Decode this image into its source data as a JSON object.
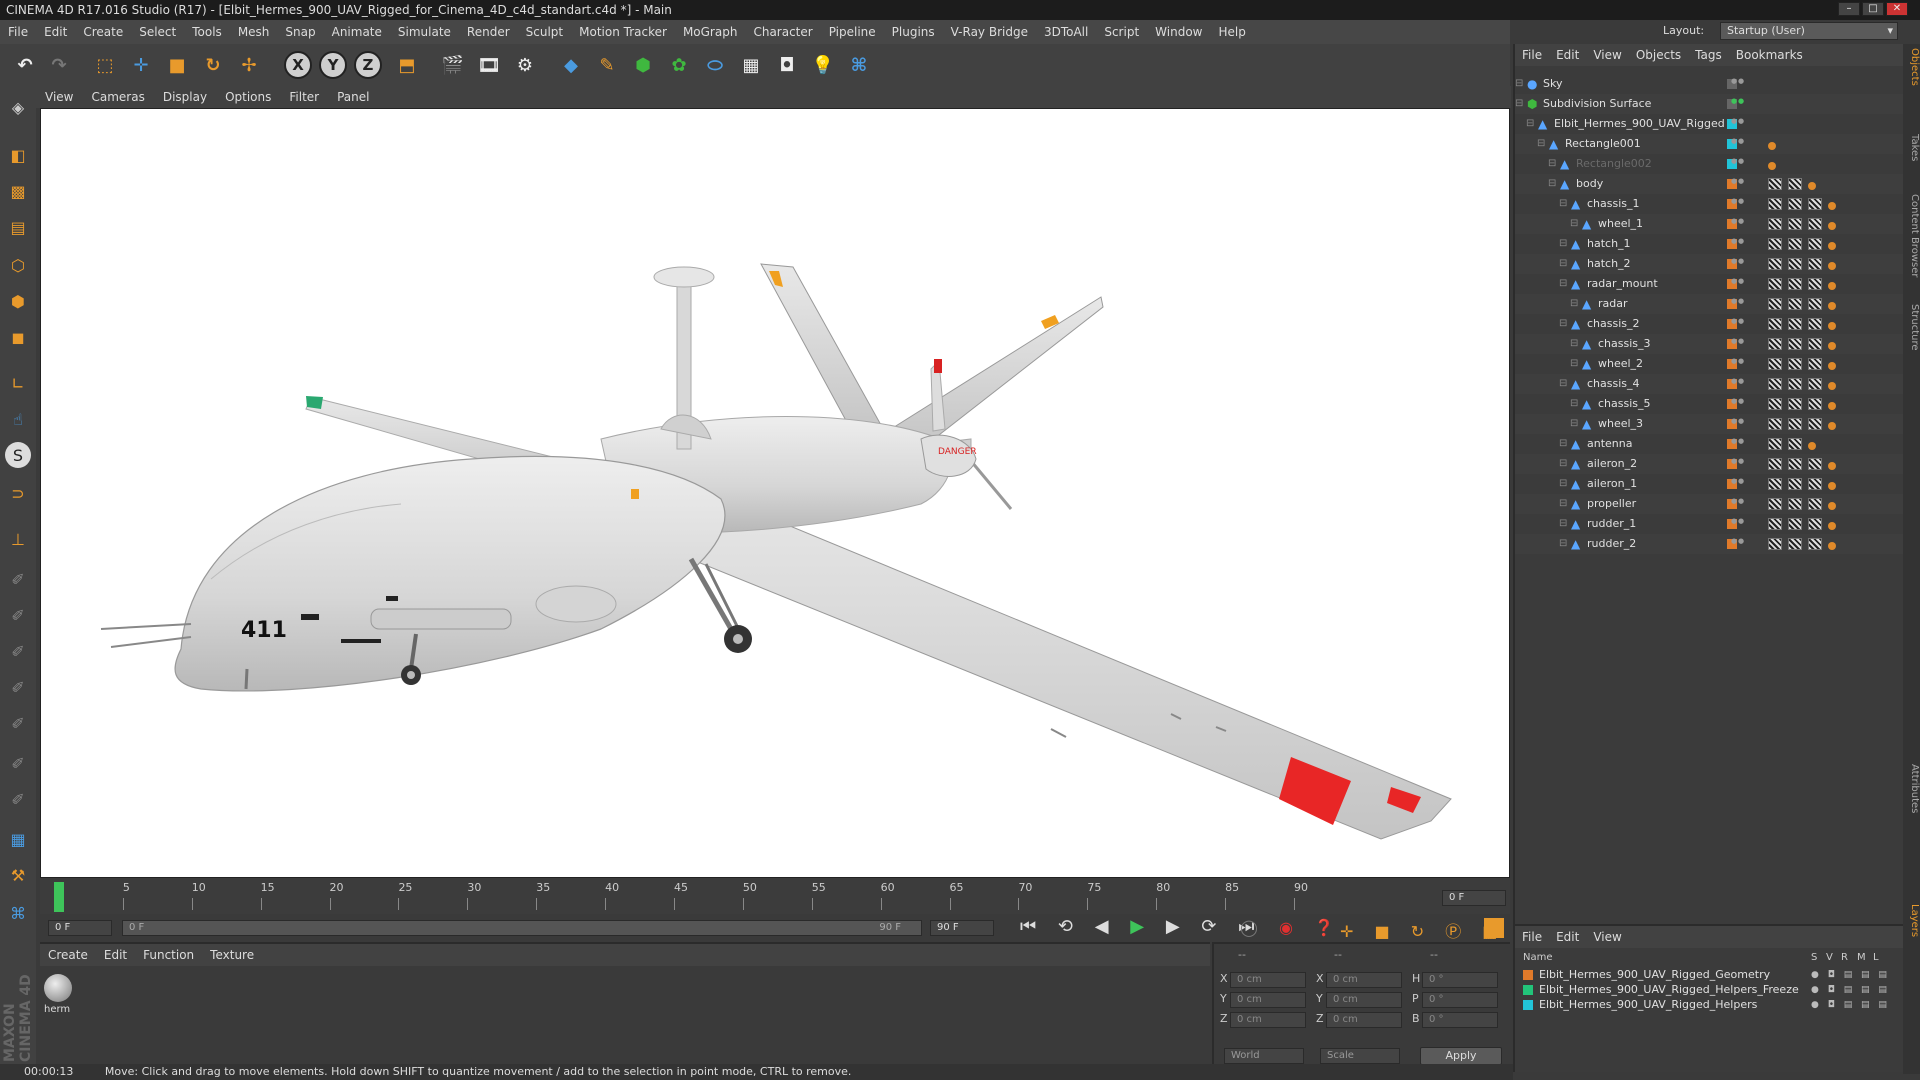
{
  "window": {
    "title": "CINEMA 4D R17.016 Studio (R17) - [Elbit_Hermes_900_UAV_Rigged_for_Cinema_4D_c4d_standart.c4d *] - Main"
  },
  "menubar": [
    "File",
    "Edit",
    "Create",
    "Select",
    "Tools",
    "Mesh",
    "Snap",
    "Animate",
    "Simulate",
    "Render",
    "Sculpt",
    "Motion Tracker",
    "MoGraph",
    "Character",
    "Pipeline",
    "Plugins",
    "V-Ray Bridge",
    "3DToAll",
    "Script",
    "Window",
    "Help"
  ],
  "layout": {
    "label": "Layout:",
    "value": "Startup (User)"
  },
  "toolbar": {
    "x_label": "X",
    "y_label": "Y",
    "z_label": "Z"
  },
  "viewport": {
    "menu": [
      "View",
      "Cameras",
      "Display",
      "Options",
      "Filter",
      "Panel"
    ],
    "tail_number": "411",
    "warning_text": "DANGER"
  },
  "timeline": {
    "ticks": [
      "0",
      "5",
      "10",
      "15",
      "20",
      "25",
      "30",
      "35",
      "40",
      "45",
      "50",
      "55",
      "60",
      "65",
      "70",
      "75",
      "80",
      "85",
      "90"
    ],
    "current_frame": "0 F",
    "start_field": "0 F",
    "range_start": "0 F",
    "range_end": "90 F",
    "end_field": "90 F"
  },
  "material_manager": {
    "menu": [
      "Create",
      "Edit",
      "Function",
      "Texture"
    ],
    "material_name": "herm"
  },
  "coordinates": {
    "header": [
      "--",
      "--",
      "--"
    ],
    "rows": [
      {
        "a": "X",
        "av": "0 cm",
        "b": "X",
        "bv": "0 cm",
        "c": "H",
        "cv": "0 °"
      },
      {
        "a": "Y",
        "av": "0 cm",
        "b": "Y",
        "bv": "0 cm",
        "c": "P",
        "cv": "0 °"
      },
      {
        "a": "Z",
        "av": "0 cm",
        "b": "Z",
        "bv": "0 cm",
        "c": "B",
        "cv": "0 °"
      }
    ],
    "mode": "World",
    "scale": "Scale",
    "apply": "Apply"
  },
  "object_manager": {
    "menu": [
      "File",
      "Edit",
      "View",
      "Objects",
      "Tags",
      "Bookmarks"
    ],
    "objects": [
      {
        "name": "Sky",
        "depth": 0,
        "color": "none",
        "tags": 0
      },
      {
        "name": "Subdivision Surface",
        "depth": 0,
        "color": "none",
        "tags": 0
      },
      {
        "name": "Elbit_Hermes_900_UAV_Rigged",
        "depth": 1,
        "color": "#22c4d8",
        "tags": 0
      },
      {
        "name": "Rectangle001",
        "depth": 2,
        "color": "#22c4d8",
        "tags": 1
      },
      {
        "name": "Rectangle002",
        "depth": 3,
        "color": "#22c4d8",
        "tags": 1
      },
      {
        "name": "body",
        "depth": 3,
        "color": "#e07a2a",
        "tags": 3
      },
      {
        "name": "chassis_1",
        "depth": 4,
        "color": "#e07a2a",
        "tags": 4
      },
      {
        "name": "wheel_1",
        "depth": 5,
        "color": "#e07a2a",
        "tags": 4
      },
      {
        "name": "hatch_1",
        "depth": 4,
        "color": "#e07a2a",
        "tags": 4
      },
      {
        "name": "hatch_2",
        "depth": 4,
        "color": "#e07a2a",
        "tags": 4
      },
      {
        "name": "radar_mount",
        "depth": 4,
        "color": "#e07a2a",
        "tags": 4
      },
      {
        "name": "radar",
        "depth": 5,
        "color": "#e07a2a",
        "tags": 4
      },
      {
        "name": "chassis_2",
        "depth": 4,
        "color": "#e07a2a",
        "tags": 4
      },
      {
        "name": "chassis_3",
        "depth": 5,
        "color": "#e07a2a",
        "tags": 4
      },
      {
        "name": "wheel_2",
        "depth": 5,
        "color": "#e07a2a",
        "tags": 4
      },
      {
        "name": "chassis_4",
        "depth": 4,
        "color": "#e07a2a",
        "tags": 4
      },
      {
        "name": "chassis_5",
        "depth": 5,
        "color": "#e07a2a",
        "tags": 4
      },
      {
        "name": "wheel_3",
        "depth": 5,
        "color": "#e07a2a",
        "tags": 4
      },
      {
        "name": "antenna",
        "depth": 4,
        "color": "#e07a2a",
        "tags": 3
      },
      {
        "name": "aileron_2",
        "depth": 4,
        "color": "#e07a2a",
        "tags": 4
      },
      {
        "name": "aileron_1",
        "depth": 4,
        "color": "#e07a2a",
        "tags": 4
      },
      {
        "name": "propeller",
        "depth": 4,
        "color": "#e07a2a",
        "tags": 4
      },
      {
        "name": "rudder_1",
        "depth": 4,
        "color": "#e07a2a",
        "tags": 4
      },
      {
        "name": "rudder_2",
        "depth": 4,
        "color": "#e07a2a",
        "tags": 4
      }
    ]
  },
  "side_tabs": [
    "Objects",
    "Takes",
    "Content Browser",
    "Structure",
    "Attributes",
    "Layers"
  ],
  "layer_manager": {
    "menu": [
      "File",
      "Edit",
      "View"
    ],
    "columns": [
      "Name",
      "S",
      "V",
      "R",
      "M",
      "L"
    ],
    "layers": [
      {
        "name": "Elbit_Hermes_900_UAV_Rigged_Geometry",
        "color": "#e07a2a"
      },
      {
        "name": "Elbit_Hermes_900_UAV_Rigged_Helpers_Freeze",
        "color": "#22c47a"
      },
      {
        "name": "Elbit_Hermes_900_UAV_Rigged_Helpers",
        "color": "#22c4d8"
      }
    ]
  },
  "status": {
    "time": "00:00:13",
    "message": "Move: Click and drag to move elements. Hold down SHIFT to quantize movement / add to the selection in point mode, CTRL to remove."
  },
  "brand": "MAXON CINEMA 4D"
}
